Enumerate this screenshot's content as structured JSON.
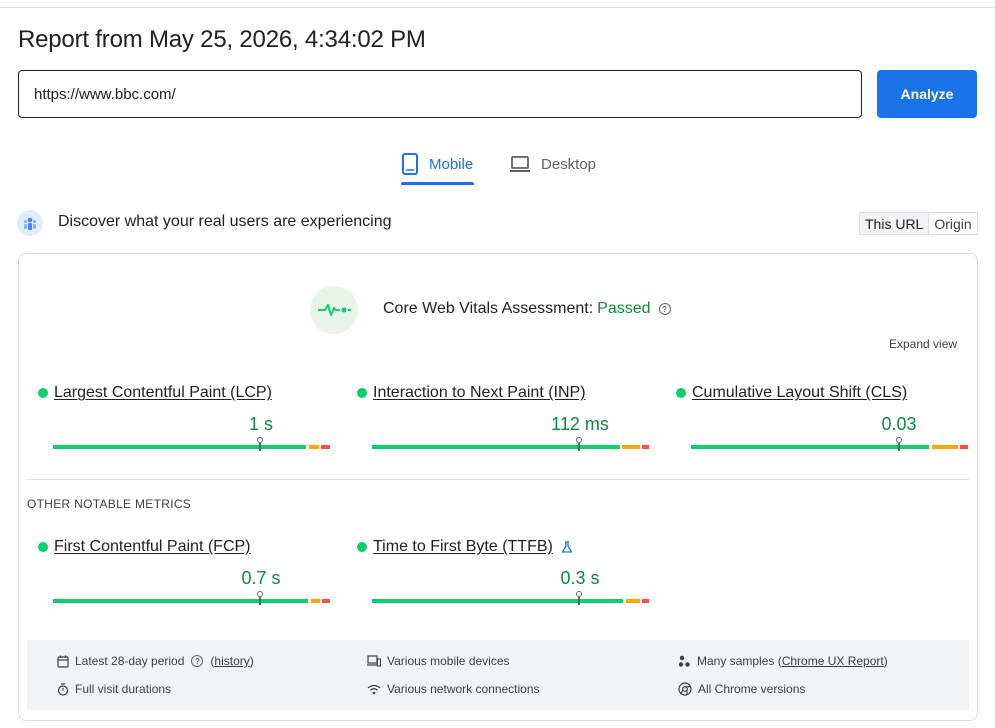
{
  "header": {
    "title": "Report from May 25, 2026, 4:34:02 PM",
    "url_value": "https://www.bbc.com/",
    "analyze_label": "Analyze"
  },
  "tabs": [
    {
      "label": "Mobile",
      "icon": "smartphone-icon",
      "active": true
    },
    {
      "label": "Desktop",
      "icon": "laptop-icon",
      "active": false
    }
  ],
  "crux": {
    "title": "Discover what your real users are experiencing",
    "toggle": [
      {
        "label": "This URL",
        "active": true
      },
      {
        "label": "Origin",
        "active": false
      }
    ]
  },
  "assessment": {
    "label": "Core Web Vitals Assessment:",
    "status": "Passed",
    "expand_label": "Expand view"
  },
  "core_metrics": [
    {
      "name": "Largest Contentful Paint (LCP)",
      "value": "1 s",
      "rating": "good",
      "position": 0.75
    },
    {
      "name": "Interaction to Next Paint (INP)",
      "value": "112 ms",
      "rating": "good",
      "position": 0.75
    },
    {
      "name": "Cumulative Layout Shift (CLS)",
      "value": "0.03",
      "rating": "good",
      "position": 0.75
    }
  ],
  "other_label": "OTHER NOTABLE METRICS",
  "other_metrics": [
    {
      "name": "First Contentful Paint (FCP)",
      "value": "0.7 s",
      "rating": "good",
      "position": 0.75
    },
    {
      "name": "Time to First Byte (TTFB)",
      "value": "0.3 s",
      "rating": "good",
      "position": 0.75,
      "experimental": true
    }
  ],
  "footer": {
    "period": "Latest 28-day period",
    "history_link": "history",
    "devices": "Various mobile devices",
    "samples_prefix": "Many samples (",
    "samples_link": "Chrome UX Report",
    "samples_suffix": ")",
    "durations": "Full visit durations",
    "network": "Various network connections",
    "chrome": "All Chrome versions"
  },
  "colors": {
    "accent": "#1a73e8",
    "good": "#0cce6b",
    "needs_improvement": "#ffa400",
    "poor": "#ff4e42",
    "passed_text": "#0d8a3e"
  }
}
